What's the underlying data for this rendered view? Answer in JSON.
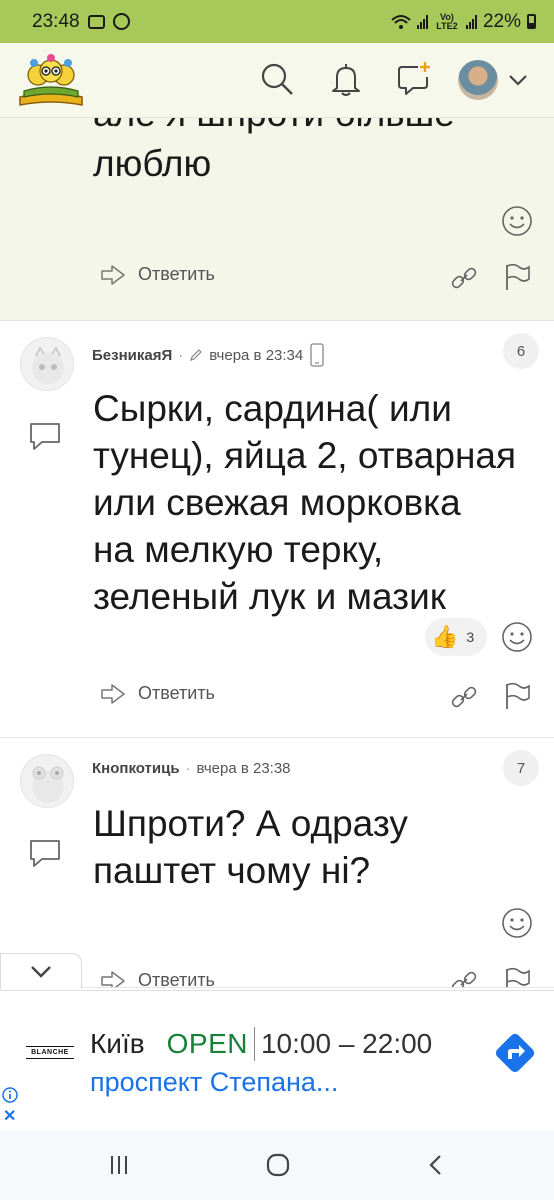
{
  "status_bar": {
    "time": "23:48",
    "network_label": "Vo) LTE2",
    "battery_percent": "22%"
  },
  "header": {
    "logo_icon": "owls-on-books-logo",
    "search_icon": "search-icon",
    "bell_icon": "bell-icon",
    "new_post_icon": "new-post-icon",
    "profile_chevron_icon": "chevron-down-icon"
  },
  "previous_comment": {
    "text_clipped": "але я шпроти більше",
    "text_last_line": "люблю",
    "reply_label": "Ответить"
  },
  "comments": [
    {
      "author": "БезникаяЯ",
      "edited_icon": "pencil-icon",
      "time": "вчера в 23:34",
      "device_icon": "phone-icon",
      "number": "6",
      "body_lines": [
        "Сырки, сардина( или",
        "тунец), яйца 2, отварная",
        "или свежая морковка",
        "на мелкую терку,",
        "зеленый лук и мазик"
      ],
      "like_emoji": "👍",
      "like_count": "3",
      "reply_label": "Ответить"
    },
    {
      "author": "Кнопкотиць",
      "time": "вчера в 23:38",
      "number": "7",
      "body_lines": [
        "Шпроти? А одразу",
        "паштет чому ні?"
      ],
      "reply_label": "Ответить"
    }
  ],
  "ad": {
    "brand": "BLANCHE",
    "city": "Київ",
    "status": "OPEN",
    "hours": "10:00 – 22:00",
    "address": "проспект Степана...",
    "close_glyph": "✕"
  },
  "colors": {
    "status_bar_bg": "#a7c95a",
    "header_bg": "#f5f8ea",
    "previous_comment_bg": "#f3f6e8",
    "ad_open_green": "#188038",
    "ad_link_blue": "#1a73e8"
  }
}
